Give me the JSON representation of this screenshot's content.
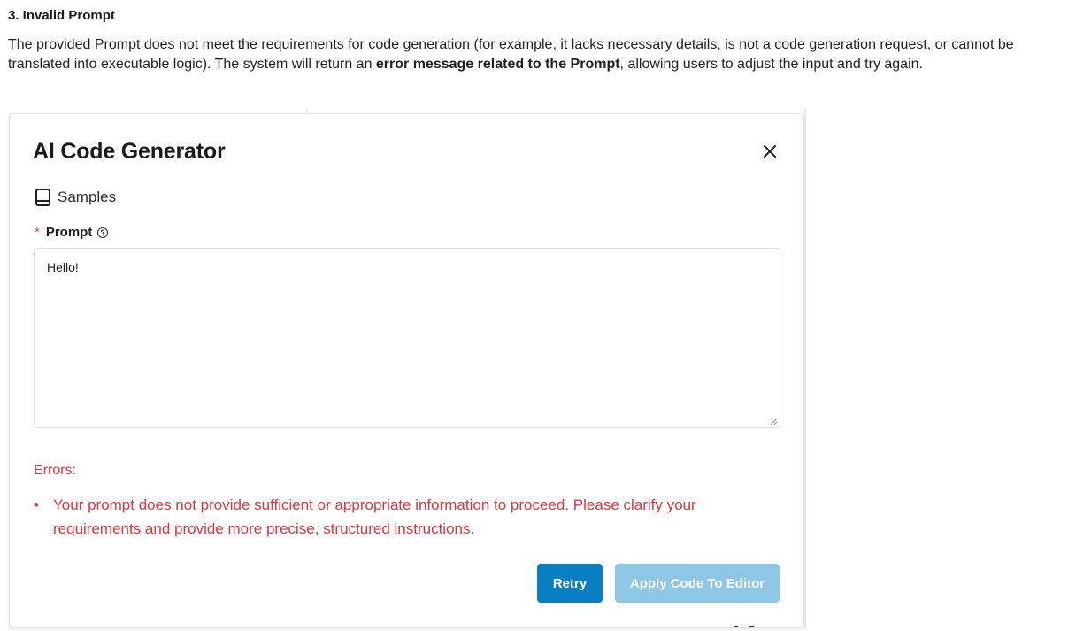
{
  "document": {
    "heading": "3. Invalid Prompt",
    "paragraph_part1": "The provided Prompt does not meet the requirements for code generation (for example, it lacks necessary details, is not a code generation request, or cannot be translated into executable logic). The system will return an ",
    "paragraph_bold": "error message related to the Prompt",
    "paragraph_part2": ", allowing users to adjust the input and try again."
  },
  "modal": {
    "title": "AI Code Generator",
    "close_icon": "close-icon",
    "samples": {
      "icon": "book-icon",
      "label": "Samples"
    },
    "prompt": {
      "required_mark": "*",
      "label": "Prompt",
      "help_icon": "question-circle-icon",
      "value": "Hello!"
    },
    "errors": {
      "title": "Errors:",
      "items": [
        "Your prompt does not provide sufficient or appropriate information to proceed. Please clarify your requirements and provide more precise, structured instructions."
      ]
    },
    "buttons": {
      "retry": "Retry",
      "apply": "Apply Code To Editor"
    }
  },
  "colors": {
    "error": "#d9363e",
    "primary": "#0a7ec2",
    "primary_disabled": "#8ec6e6",
    "required": "#e5484d"
  }
}
